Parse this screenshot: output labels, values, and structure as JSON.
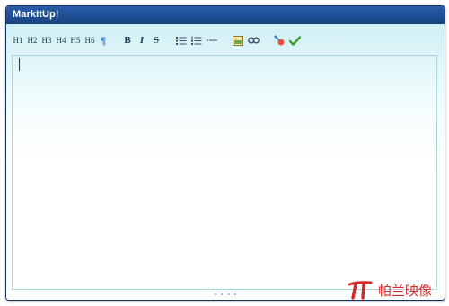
{
  "window": {
    "title": "MarkItUp!"
  },
  "toolbar": {
    "headings": [
      "H1",
      "H2",
      "H3",
      "H4",
      "H5",
      "H6"
    ],
    "paragraph": "¶",
    "bold": "B",
    "italic": "I",
    "strike": "S"
  },
  "icons": {
    "bulleted_list": "bulleted-list-icon",
    "numbered_list": "numbered-list-icon",
    "horizontal_rule": "horizontal-rule-icon",
    "picture": "picture-icon",
    "link": "link-icon",
    "clean": "clean-icon",
    "preview": "preview-check-icon"
  },
  "watermark": {
    "text": "帕兰映像"
  },
  "colors": {
    "titlebar": "#1f4f95",
    "accent": "#3b7fd1",
    "watermark": "#d62a2a"
  }
}
